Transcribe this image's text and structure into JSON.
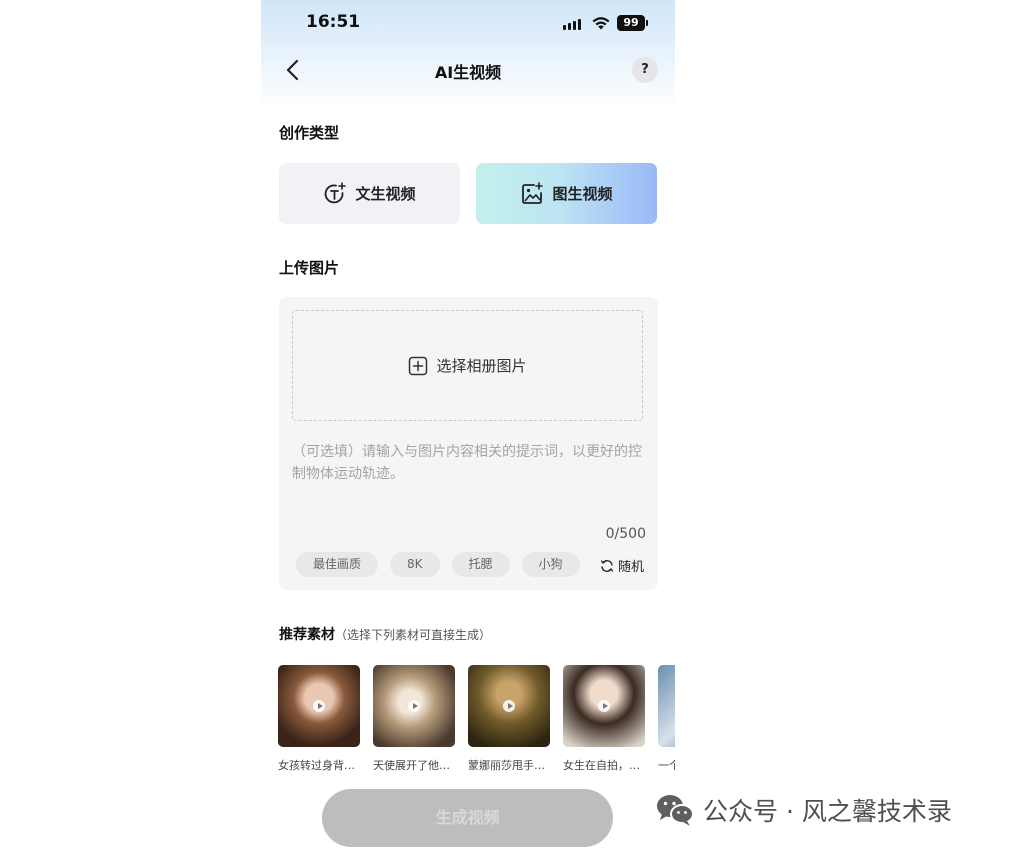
{
  "status_bar": {
    "time": "16:51",
    "battery": "99"
  },
  "nav": {
    "title": "AI生视频",
    "help": "?"
  },
  "creation_type": {
    "label": "创作类型",
    "options": [
      {
        "label": "文生视频",
        "selected": false
      },
      {
        "label": "图生视频",
        "selected": true
      }
    ]
  },
  "upload": {
    "label": "上传图片",
    "select_label": "选择相册图片",
    "prompt_placeholder": "（可选填）请输入与图片内容相关的提示词，以更好的控制物体运动轨迹。",
    "counter": "0/500",
    "chips": [
      "最佳画质",
      "8K",
      "托腮",
      "小狗"
    ],
    "random_label": "随机"
  },
  "recommend": {
    "title": "推荐素材",
    "subtitle": "（选择下列素材可直接生成）",
    "items": [
      {
        "caption": "女孩转过身背…"
      },
      {
        "caption": "天使展开了他…"
      },
      {
        "caption": "蒙娜丽莎甩手…"
      },
      {
        "caption": "女生在自拍，…"
      },
      {
        "caption": "一个"
      }
    ]
  },
  "generate_button": "生成视频",
  "watermark": "公众号 · 风之馨技术录",
  "colors": {
    "accent_gradient_start": "#c3f0ec",
    "accent_gradient_end": "#9ab8f7",
    "disabled_button": "#bdbdc0"
  }
}
